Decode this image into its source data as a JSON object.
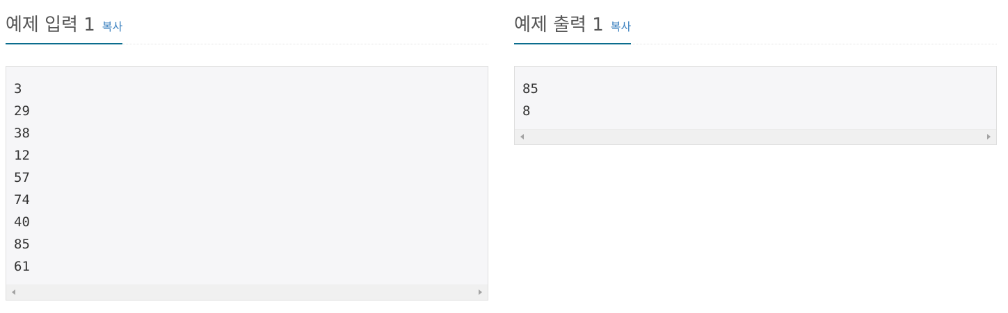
{
  "input": {
    "title": "예제 입력 1",
    "copy_label": "복사",
    "lines": [
      "3",
      "29",
      "38",
      "12",
      "57",
      "74",
      "40",
      "85",
      "61"
    ]
  },
  "output": {
    "title": "예제 출력 1",
    "copy_label": "복사",
    "lines": [
      "85",
      "8"
    ]
  },
  "colors": {
    "accent_underline": "#0b6d8e",
    "copy_link": "#3b80bf",
    "title_text": "#555555",
    "sample_bg": "#f6f6f8"
  }
}
